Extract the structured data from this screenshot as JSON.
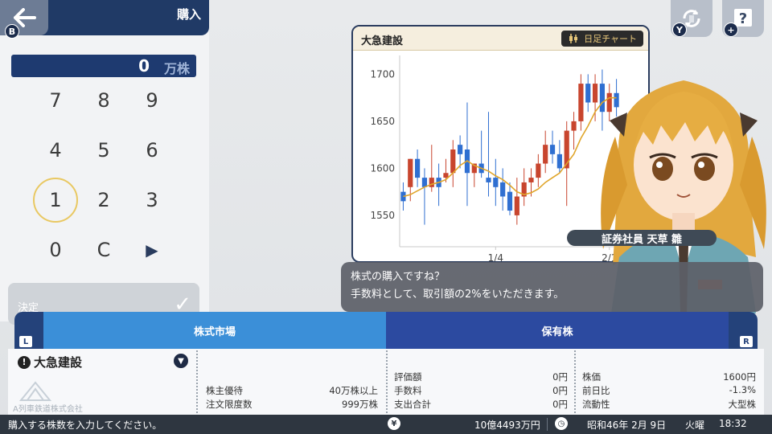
{
  "header": {
    "title": "購入",
    "back_badge": "B"
  },
  "quantity": {
    "value": "0",
    "unit": "万株"
  },
  "keypad": {
    "keys": [
      "7",
      "8",
      "9",
      "4",
      "5",
      "6",
      "1",
      "2",
      "3",
      "0",
      "C",
      "▶"
    ],
    "selected": "1"
  },
  "decide": {
    "label": "決定",
    "check": "✓"
  },
  "top_buttons": {
    "refresh_badge": "Y",
    "help_label": "?",
    "help_badge": "+"
  },
  "chart_panel": {
    "title": "大急建設",
    "chart_type_label": "日足チャート"
  },
  "chart_data": {
    "type": "candlestick",
    "x_tick_labels": [
      "1/4",
      "2/1"
    ],
    "y_ticks": [
      1550,
      1600,
      1650,
      1700
    ],
    "ylim": [
      1520,
      1720
    ],
    "candles": [
      {
        "o": 1575,
        "h": 1585,
        "c": 1565,
        "l": 1555,
        "up": false
      },
      {
        "o": 1580,
        "h": 1610,
        "c": 1610,
        "l": 1565,
        "up": true
      },
      {
        "o": 1610,
        "h": 1620,
        "c": 1590,
        "l": 1580,
        "up": false
      },
      {
        "o": 1590,
        "h": 1600,
        "c": 1580,
        "l": 1540,
        "up": false
      },
      {
        "o": 1580,
        "h": 1625,
        "c": 1590,
        "l": 1575,
        "up": true
      },
      {
        "o": 1590,
        "h": 1605,
        "c": 1580,
        "l": 1560,
        "up": false
      },
      {
        "o": 1590,
        "h": 1610,
        "c": 1595,
        "l": 1585,
        "up": true
      },
      {
        "o": 1595,
        "h": 1630,
        "c": 1620,
        "l": 1580,
        "up": true
      },
      {
        "o": 1625,
        "h": 1635,
        "c": 1615,
        "l": 1600,
        "up": false
      },
      {
        "o": 1620,
        "h": 1670,
        "c": 1595,
        "l": 1560,
        "up": false
      },
      {
        "o": 1595,
        "h": 1605,
        "c": 1605,
        "l": 1580,
        "up": true
      },
      {
        "o": 1605,
        "h": 1640,
        "c": 1595,
        "l": 1590,
        "up": false
      },
      {
        "o": 1590,
        "h": 1660,
        "c": 1585,
        "l": 1570,
        "up": false
      },
      {
        "o": 1590,
        "h": 1610,
        "c": 1580,
        "l": 1560,
        "up": false
      },
      {
        "o": 1585,
        "h": 1600,
        "c": 1570,
        "l": 1555,
        "up": false
      },
      {
        "o": 1575,
        "h": 1585,
        "c": 1555,
        "l": 1550,
        "up": false
      },
      {
        "o": 1550,
        "h": 1590,
        "c": 1570,
        "l": 1540,
        "up": true
      },
      {
        "o": 1570,
        "h": 1600,
        "c": 1585,
        "l": 1560,
        "up": true
      },
      {
        "o": 1585,
        "h": 1600,
        "c": 1590,
        "l": 1570,
        "up": true
      },
      {
        "o": 1590,
        "h": 1615,
        "c": 1605,
        "l": 1580,
        "up": true
      },
      {
        "o": 1605,
        "h": 1640,
        "c": 1625,
        "l": 1595,
        "up": true
      },
      {
        "o": 1625,
        "h": 1640,
        "c": 1615,
        "l": 1605,
        "up": false
      },
      {
        "o": 1615,
        "h": 1630,
        "c": 1600,
        "l": 1595,
        "up": false
      },
      {
        "o": 1600,
        "h": 1650,
        "c": 1640,
        "l": 1560,
        "up": true
      },
      {
        "o": 1640,
        "h": 1660,
        "c": 1650,
        "l": 1620,
        "up": true
      },
      {
        "o": 1650,
        "h": 1700,
        "c": 1690,
        "l": 1640,
        "up": true
      },
      {
        "o": 1690,
        "h": 1700,
        "c": 1670,
        "l": 1660,
        "up": false
      },
      {
        "o": 1670,
        "h": 1700,
        "c": 1690,
        "l": 1650,
        "up": true
      },
      {
        "o": 1690,
        "h": 1705,
        "c": 1660,
        "l": 1640,
        "up": false
      },
      {
        "o": 1660,
        "h": 1690,
        "c": 1680,
        "l": 1650,
        "up": true
      },
      {
        "o": 1680,
        "h": 1695,
        "c": 1665,
        "l": 1655,
        "up": false
      }
    ],
    "moving_average": [
      1570,
      1572,
      1576,
      1580,
      1583,
      1585,
      1588,
      1595,
      1603,
      1608,
      1603,
      1600,
      1597,
      1592,
      1588,
      1582,
      1575,
      1572,
      1574,
      1578,
      1585,
      1590,
      1595,
      1605,
      1615,
      1632,
      1645,
      1660,
      1670,
      1675,
      1675
    ]
  },
  "character": {
    "name_plate": "証券社員 天草 雛"
  },
  "dialogue": {
    "line1": "株式の購入ですね？",
    "line2": "手数料として、取引額の2%をいただきます。"
  },
  "tabs": {
    "left_badge": "L",
    "right_badge": "R",
    "market": "株式市場",
    "holdings": "保有株"
  },
  "info": {
    "stock_name": "大急建設",
    "company_watermark": "A列車鉄道株式会社",
    "col1": [
      {
        "label": "株主優待",
        "value": "40万株以上"
      },
      {
        "label": "注文限度数",
        "value": "999万株"
      }
    ],
    "col2": [
      {
        "label": "評価額",
        "value": "0円"
      },
      {
        "label": "手数料",
        "value": "0円"
      },
      {
        "label": "支出合計",
        "value": "0円"
      }
    ],
    "col3": [
      {
        "label": "株価",
        "value": "1600円"
      },
      {
        "label": "前日比",
        "value": "-1.3%"
      },
      {
        "label": "流動性",
        "value": "大型株"
      }
    ]
  },
  "status": {
    "message": "購入する株数を入力してください。",
    "yen_icon": "¥",
    "funds": "10億4493万円",
    "date": "昭和46年 2月 9日",
    "weekday": "火曜",
    "time": "18:32"
  },
  "colors": {
    "header": "#203a66",
    "tab_market": "#3b8fd8",
    "tab_holdings": "#2c4aa0",
    "candle_up": "#c8452e",
    "candle_down": "#2f6fd1",
    "ma_line": "#e0a52a"
  }
}
